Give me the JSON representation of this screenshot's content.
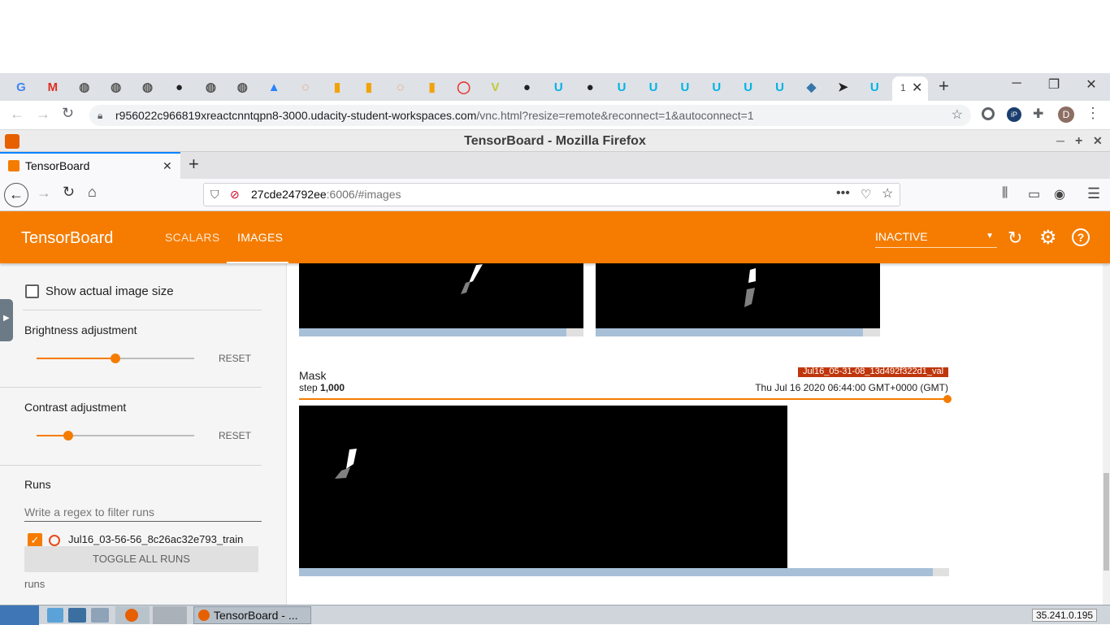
{
  "chrome": {
    "tab_favicons": [
      "google-icon",
      "gmail-icon",
      "globe-icon",
      "globe-icon",
      "globe-icon",
      "github-icon",
      "globe-icon",
      "globe-icon",
      "atlassian-icon",
      "jupyter-icon",
      "book-icon",
      "book-icon",
      "jupyter-icon",
      "book-icon",
      "power-icon",
      "vnc-icon",
      "github-icon",
      "udacity-icon",
      "github-icon",
      "udacity-icon",
      "udacity-icon",
      "udacity-icon",
      "udacity-icon",
      "udacity-icon",
      "udacity-icon",
      "python-icon",
      "cursor-icon",
      "udacity-icon"
    ],
    "active_tab_label": "1",
    "url_host": "r956022c966819xreactcnntqpn8-3000.udacity-student-workspaces.com",
    "url_path": "/vnc.html?resize=remote&reconnect=1&autoconnect=1",
    "profile_initial": "D"
  },
  "vnc": {
    "window_title": "TensorBoard - Mozilla Firefox"
  },
  "firefox": {
    "tab_title": "TensorBoard",
    "url_host": "27cde24792ee",
    "url_rest": ":6006/#images"
  },
  "tensorboard": {
    "title": "TensorBoard",
    "tabs": [
      "SCALARS",
      "IMAGES"
    ],
    "active_tab": "IMAGES",
    "status": "INACTIVE",
    "accent": "#f57c00"
  },
  "sidebar": {
    "show_actual_size_label": "Show actual image size",
    "brightness_label": "Brightness adjustment",
    "brightness_value": 0.5,
    "contrast_label": "Contrast adjustment",
    "contrast_value": 0.2,
    "reset_label": "RESET",
    "runs_heading": "Runs",
    "runs_filter_placeholder": "Write a regex to filter runs",
    "run_name": "Jul16_03-56-56_8c26ac32e793_train",
    "toggle_all_label": "TOGGLE ALL RUNS",
    "runs_footer": "runs"
  },
  "main": {
    "card_title": "Mask",
    "step_prefix": "step",
    "step_value": "1,000",
    "run_badge": "Jul16_05-31-08_13d492f322d1_val",
    "timestamp": "Thu Jul 16 2020 06:44:00 GMT+0000 (GMT)",
    "top_progress_a": 0.94,
    "top_progress_b": 0.94,
    "main_progress": 0.975
  },
  "taskbar": {
    "task_label": "TensorBoard - ...",
    "ip": "35.241.0.195"
  }
}
